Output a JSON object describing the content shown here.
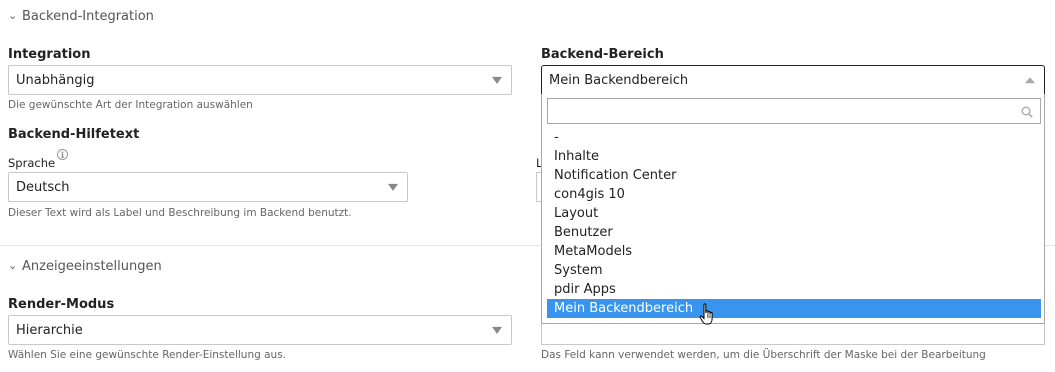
{
  "sections": {
    "backend": {
      "legend": "Backend-Integration"
    },
    "display": {
      "legend": "Anzeigeeinstellungen"
    }
  },
  "fields": {
    "integration": {
      "label": "Integration",
      "value": "Unabhängig",
      "help": "Die gewünschte Art der Integration auswählen"
    },
    "backend_area": {
      "label": "Backend-Bereich",
      "value": "Mein Backendbereich"
    },
    "helptext": {
      "label": "Backend-Hilfetext",
      "language_label": "Sprache",
      "language_value": "Deutsch",
      "help": "Dieser Text wird als Label und Beschreibung im Backend benutzt.",
      "hidden_label_fragment": "L"
    },
    "render_mode": {
      "label": "Render-Modus",
      "value": "Hierarchie",
      "help": "Wählen Sie eine gewünschte Render-Einstellung aus."
    },
    "heading_help": {
      "help": "Das Feld kann verwendet werden, um die Überschrift der Maske bei der Bearbeitung"
    }
  },
  "dropdown": {
    "search_value": "",
    "options": [
      "-",
      "Inhalte",
      "Notification Center",
      "con4gis 10",
      "Layout",
      "Benutzer",
      "MetaModels",
      "System",
      "pdir Apps",
      "Mein Backendbereich"
    ],
    "highlighted": "Mein Backendbereich"
  },
  "icons": {
    "chevron": "chevron-down-icon",
    "info": "info-icon",
    "search": "search-icon",
    "cursor": "hand-cursor-icon"
  },
  "colors": {
    "highlight": "#3894ec"
  }
}
